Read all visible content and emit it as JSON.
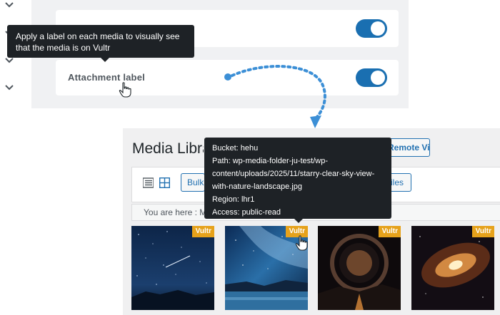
{
  "settings": {
    "tooltip_text": "Apply a label on each media to visually see that the media is on Vultr",
    "attachment_label": "Attachment label"
  },
  "media_library": {
    "title": "Media Library",
    "remote_video_button": "Remote Video",
    "bulk_button": "Bulk select",
    "files_button": "Add files",
    "breadcrumb": "You are here :  M"
  },
  "info_tooltip": {
    "bucket": "Bucket: hehu",
    "path_line1": "Path: wp-media-folder-ju-test/wp-",
    "path_line2": "content/uploads/2025/11/starry-clear-sky-view-",
    "path_line3": "with-nature-landscape.jpg",
    "region": "Region: lhr1",
    "access": "Access: public-read"
  },
  "thumbnails": [
    {
      "badge": "Vultr"
    },
    {
      "badge": "Vultr"
    },
    {
      "badge": "Vultr"
    },
    {
      "badge": "Vultr"
    }
  ],
  "colors": {
    "toggle": "#1a6fb1",
    "badge": "#e6a21b",
    "tooltip": "#1e2226",
    "dotted_arrow": "#3c8fd6"
  }
}
